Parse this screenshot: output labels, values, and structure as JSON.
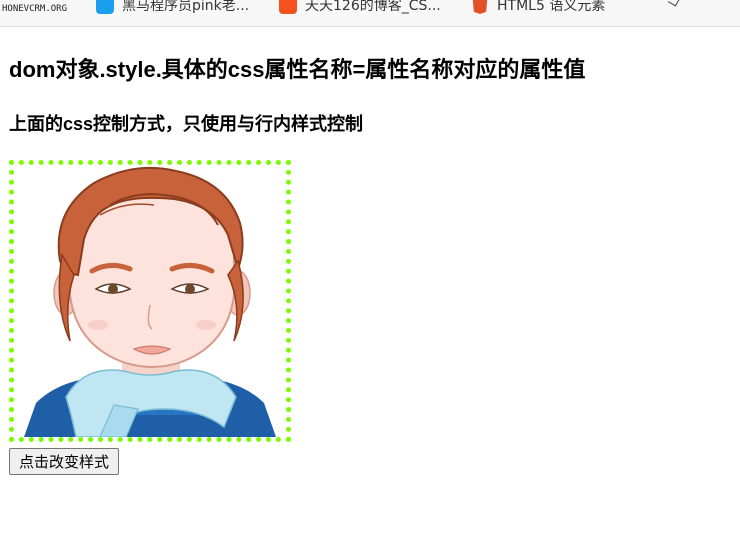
{
  "bookmarks": [
    {
      "label": "HONEVCRM.ORG",
      "icon": "honeycrm-logo-icon"
    },
    {
      "label": "黑马程序员pink老...",
      "icon": "bilibili-icon",
      "color": "#1a9ef0"
    },
    {
      "label": "天天126的博客_CS...",
      "icon": "csdn-icon",
      "color": "#f4511e"
    },
    {
      "label": "HTML5 语义元素",
      "icon": "html5-icon",
      "color": "#e34f26"
    }
  ],
  "page": {
    "title": "dom对象.style.具体的css属性名称=属性名称对应的属性值",
    "subtitle": "上面的css控制方式，只使用与行内样式控制",
    "image": {
      "icon": "cartoon-woman-avatar",
      "border_color": "#7cfc00",
      "border_style": "dotted"
    },
    "button_label": "点击改变样式"
  }
}
